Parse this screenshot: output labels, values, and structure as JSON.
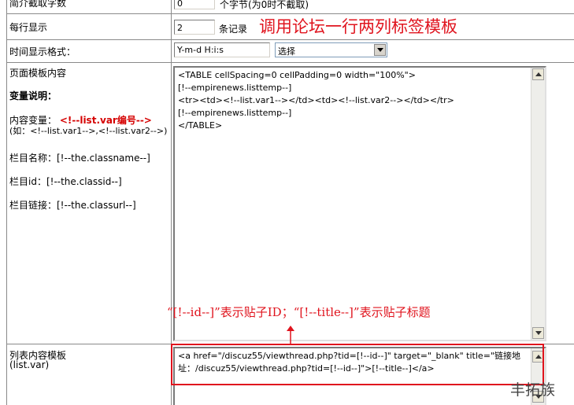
{
  "rows": {
    "trunc": {
      "label": "简介截取字数",
      "value": "0",
      "unit": "个字节(为0时不截取)"
    },
    "per_row": {
      "label": "每行显示",
      "value": "2",
      "unit": "条记录"
    },
    "time_format": {
      "label": "时间显示格式：",
      "value": "Y-m-d H:i:s",
      "select_value": "选择"
    },
    "page_template": {
      "label": "页面模板内容",
      "var_desc_title": "变量说明：",
      "content_var_prefix": "内容变量：",
      "content_var_value": "<!--list.var编号-->",
      "content_var_example": "(如：<!--list.var1-->,<!--list.var2-->)",
      "classname": "栏目名称：[!--the.classname--]",
      "classid": "栏目id：[!--the.classid--]",
      "classurl": "栏目链接：[!--the.classurl--]",
      "textarea": "<TABLE cellSpacing=0 cellPadding=0 width=\"100%\">\n[!--empirenews.listtemp--]\n<tr><td><!--list.var1--></td><td><!--list.var2--></td></tr>\n[!--empirenews.listtemp--]\n</TABLE>"
    },
    "list_template": {
      "label": "列表内容模板",
      "sublabel": "(list.var)",
      "textarea": "<a href=\"/discuz55/viewthread.php?tid=[!--id--]\" target=\"_blank\" title=\"链接地址：/discuz55/viewthread.php?tid=[!--id--]\">[!--title--]</a>"
    }
  },
  "annotations": {
    "title": "调用论坛一行两列标签模板",
    "note": "“[!--id--]”表示贴子ID；“[!--title--]”表示贴子标题",
    "watermark": "feng tuo zu"
  },
  "colors": {
    "accent": "#e0141e"
  }
}
